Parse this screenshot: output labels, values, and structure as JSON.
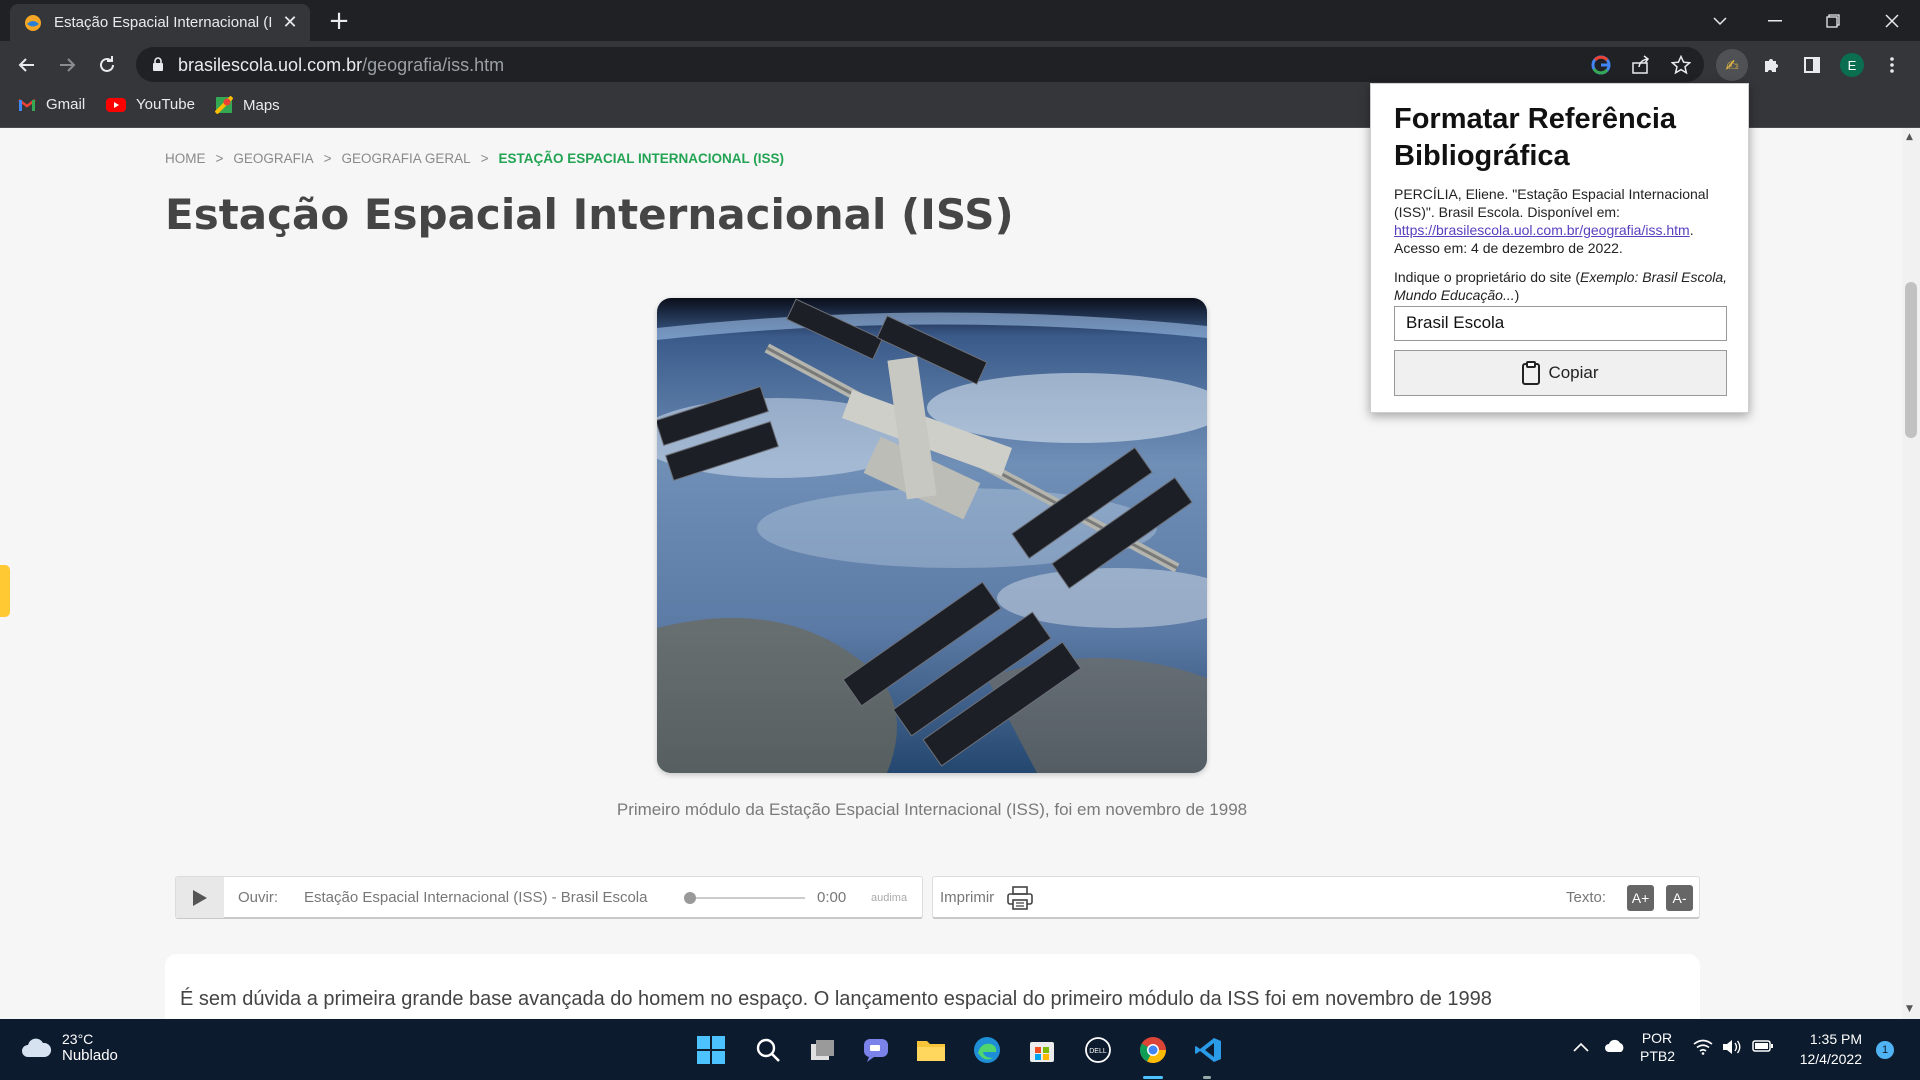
{
  "browser": {
    "tab_title": "Estação Espacial Internacional (IS",
    "url_host": "brasilescola.uol.com.br",
    "url_path": "/geografia/iss.htm",
    "profile_initial": "E",
    "bookmarks": [
      {
        "label": "Gmail",
        "icon": "gmail-icon"
      },
      {
        "label": "YouTube",
        "icon": "youtube-icon"
      },
      {
        "label": "Maps",
        "icon": "maps-icon"
      }
    ]
  },
  "page": {
    "breadcrumb": [
      "HOME",
      "GEOGRAFIA",
      "GEOGRAFIA GERAL",
      "ESTAÇÃO ESPACIAL INTERNACIONAL (ISS)"
    ],
    "breadcrumb_sep": ">",
    "title": "Estação Espacial Internacional (ISS)",
    "image_caption": "Primeiro módulo da Estação Espacial Internacional (ISS), foi em novembro de 1998",
    "player": {
      "listen_label": "Ouvir:",
      "track_title": "Estação Espacial Internacional (ISS) - Brasil Escola",
      "time": "0:00",
      "brand": "audima",
      "progress": 0
    },
    "tools": {
      "print_label": "Imprimir",
      "text_label": "Texto:",
      "increase_label": "A+",
      "decrease_label": "A-"
    },
    "article_first_line": "É sem dúvida a primeira grande base avançada do homem no espaço. O lançamento espacial do primeiro módulo da ISS foi em novembro de 1998"
  },
  "popup": {
    "title": "Formatar Referência Bibliográfica",
    "ref_text_1": "PERCÍLIA, Eliene. \"Estação Espacial Internacional (ISS)\". Brasil Escola. Disponível em: ",
    "ref_link": "https://brasilescola.uol.com.br/geografia/iss.htm",
    "ref_text_2": ". Acesso em: 4 de dezembro de 2022.",
    "hint_text": "Indique o proprietário do site (",
    "hint_example": "Exemplo: Brasil Escola, Mundo Educação...",
    "hint_close": ")",
    "owner_value": "Brasil Escola",
    "copy_label": "Copiar"
  },
  "taskbar": {
    "temperature": "23°C",
    "weather": "Nublado",
    "lang_1": "POR",
    "lang_2": "PTB2",
    "time": "1:35 PM",
    "date": "12/4/2022",
    "notifications": "1"
  },
  "colors": {
    "breadcrumb_current": "#23a454",
    "title": "#454545",
    "chrome_dark": "#202124",
    "chrome_toolbar": "#35363a",
    "taskbar": "#0d1b2e"
  }
}
